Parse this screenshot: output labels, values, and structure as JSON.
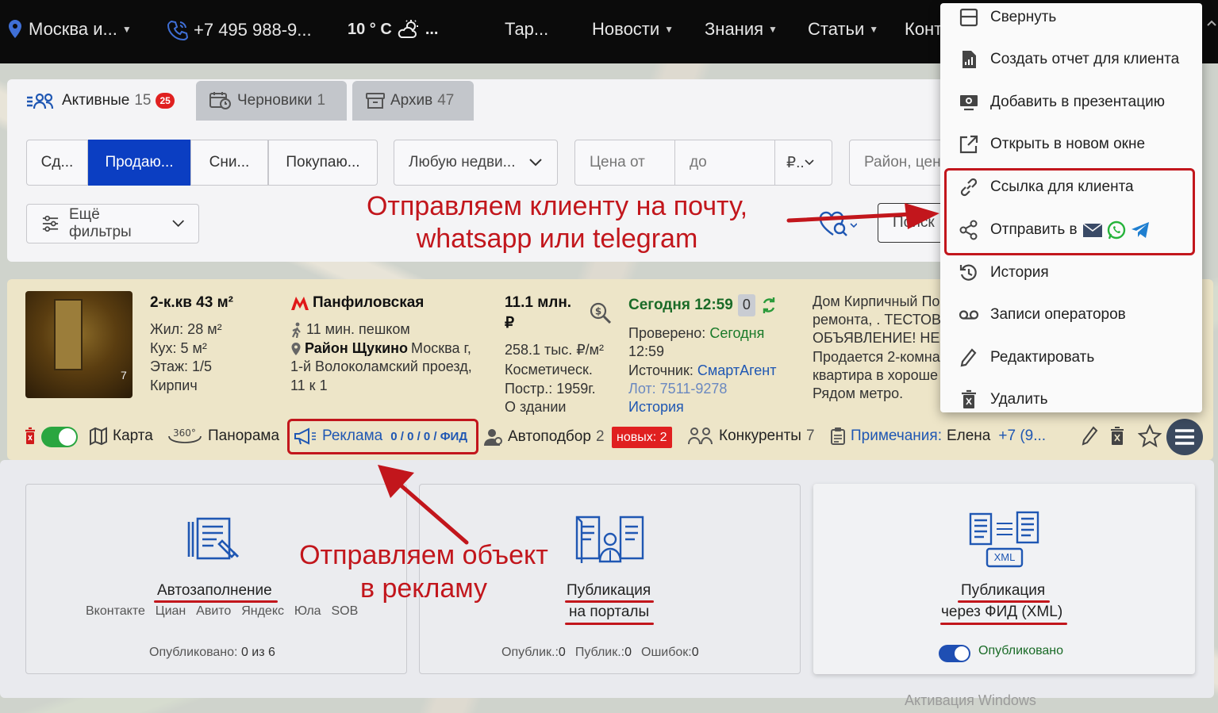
{
  "topbar": {
    "city": "Москва и...",
    "phone": "+7 495 988-9...",
    "temperature": "10 ° С",
    "weather_more": "...",
    "nav": [
      "Тар...",
      "Новости",
      "Знания",
      "Статьи",
      "Конт"
    ]
  },
  "tabs": [
    {
      "label": "Активные",
      "count": "15",
      "badge": "25"
    },
    {
      "label": "Черновики",
      "count": "1"
    },
    {
      "label": "Архив",
      "count": "47"
    }
  ],
  "filters": {
    "deal_types": [
      "Сд...",
      "Продаю...",
      "Сни...",
      "Покупаю..."
    ],
    "property_type": "Любую недви...",
    "price_from_placeholder": "Цена от",
    "price_to_placeholder": "до",
    "currency": "₽..",
    "district_placeholder": "Район, цен",
    "more_filters": "Ещё фильтры",
    "search_button": "Поиск"
  },
  "listing": {
    "photo_count": "7",
    "title": "2-к.кв 43 м²",
    "living": "Жил: 28 м²",
    "kitchen": "Кух: 5 м²",
    "floor": "Этаж: 1/5",
    "material": "Кирпич",
    "metro": "Панфиловская",
    "walk": "11 мин. пешком",
    "district": "Район Щукино",
    "address_1": "Москва г,",
    "address_2": "1-й Волоколамский проезд,",
    "address_3": "11 к 1",
    "price_1": "11.1 млн.",
    "price_2": "₽",
    "price_per_m": "258.1 тыс. ₽/м²",
    "renovation": "Косметическ.",
    "built": "Постр.: 1959г.",
    "about": "О здании",
    "date": "Сегодня 12:59",
    "date_counter": "0",
    "checked_label": "Проверено:",
    "checked_value": "Сегодня",
    "checked_time": "12:59",
    "source_label": "Источник:",
    "source_value": "СмартАгент",
    "lot": "Лот: 7511-9278",
    "history": "История",
    "desc_1": "Дом Кирпичный По",
    "desc_2": "ремонта, . ТЕСТОВО",
    "desc_3": "ОБЪЯВЛЕНИЕ! НЕ З",
    "desc_4": "Продается 2-комна",
    "desc_5": "квартира в хороше",
    "desc_6": "Рядом метро."
  },
  "actions": {
    "map": "Карта",
    "panorama": "Панорама",
    "ads": "Реклама",
    "ads_counts": "0 / 0 / 0 / ФИД",
    "autopick": "Автоподбор",
    "autopick_count": "2",
    "new_badge": "новых: 2",
    "competitors": "Конкуренты",
    "competitors_count": "7",
    "notes_label": "Примечания:",
    "notes_value": "Елена",
    "notes_more": "+7 (9..."
  },
  "publish": {
    "autofill": {
      "title": "Автозаполнение",
      "portals": "Вконтакте  Циан  Авито  Яндекс  Юла  SOB",
      "status": "Опубликовано:",
      "status_value": "0 из 6"
    },
    "portals": {
      "title_1": "Публикация",
      "title_2": "на порталы",
      "published_label": "Опублик.:",
      "published_value": "0",
      "public_label": "Публик.:",
      "public_value": "0",
      "errors_label": "Ошибок:",
      "errors_value": "0"
    },
    "feed": {
      "title_1": "Публикация",
      "title_2": "через ФИД (XML)",
      "xml": "XML",
      "toggle_label": "Опубликовано"
    }
  },
  "menu": [
    {
      "label": "Свернуть",
      "icon": "collapse-icon"
    },
    {
      "label": "Создать отчет для клиента",
      "icon": "report-icon"
    },
    {
      "label": "Добавить в презентацию",
      "icon": "presentation-icon"
    },
    {
      "label": "Открыть в новом окне",
      "icon": "external-link-icon"
    },
    {
      "label": "Ссылка для клиента",
      "icon": "link-icon"
    },
    {
      "label": "Отправить в",
      "icon": "share-icon"
    },
    {
      "label": "История",
      "icon": "history-icon"
    },
    {
      "label": "Записи операторов",
      "icon": "voicemail-icon"
    },
    {
      "label": "Редактировать",
      "icon": "pencil-icon"
    },
    {
      "label": "Удалить",
      "icon": "trash-icon"
    }
  ],
  "annotations": {
    "send_1": "Отправляем клиенту на почту,",
    "send_2": "whatsapp или telegram",
    "ads_1": "Отправляем объект",
    "ads_2": "в рекламу"
  },
  "watermark": "Активация Windows",
  "colors": {
    "accent": "#0b3ec2",
    "link": "#1f57b3",
    "annotation": "#c2161c",
    "whatsapp": "#25b33a",
    "telegram": "#1f7fd0",
    "card": "#ede5c8"
  }
}
